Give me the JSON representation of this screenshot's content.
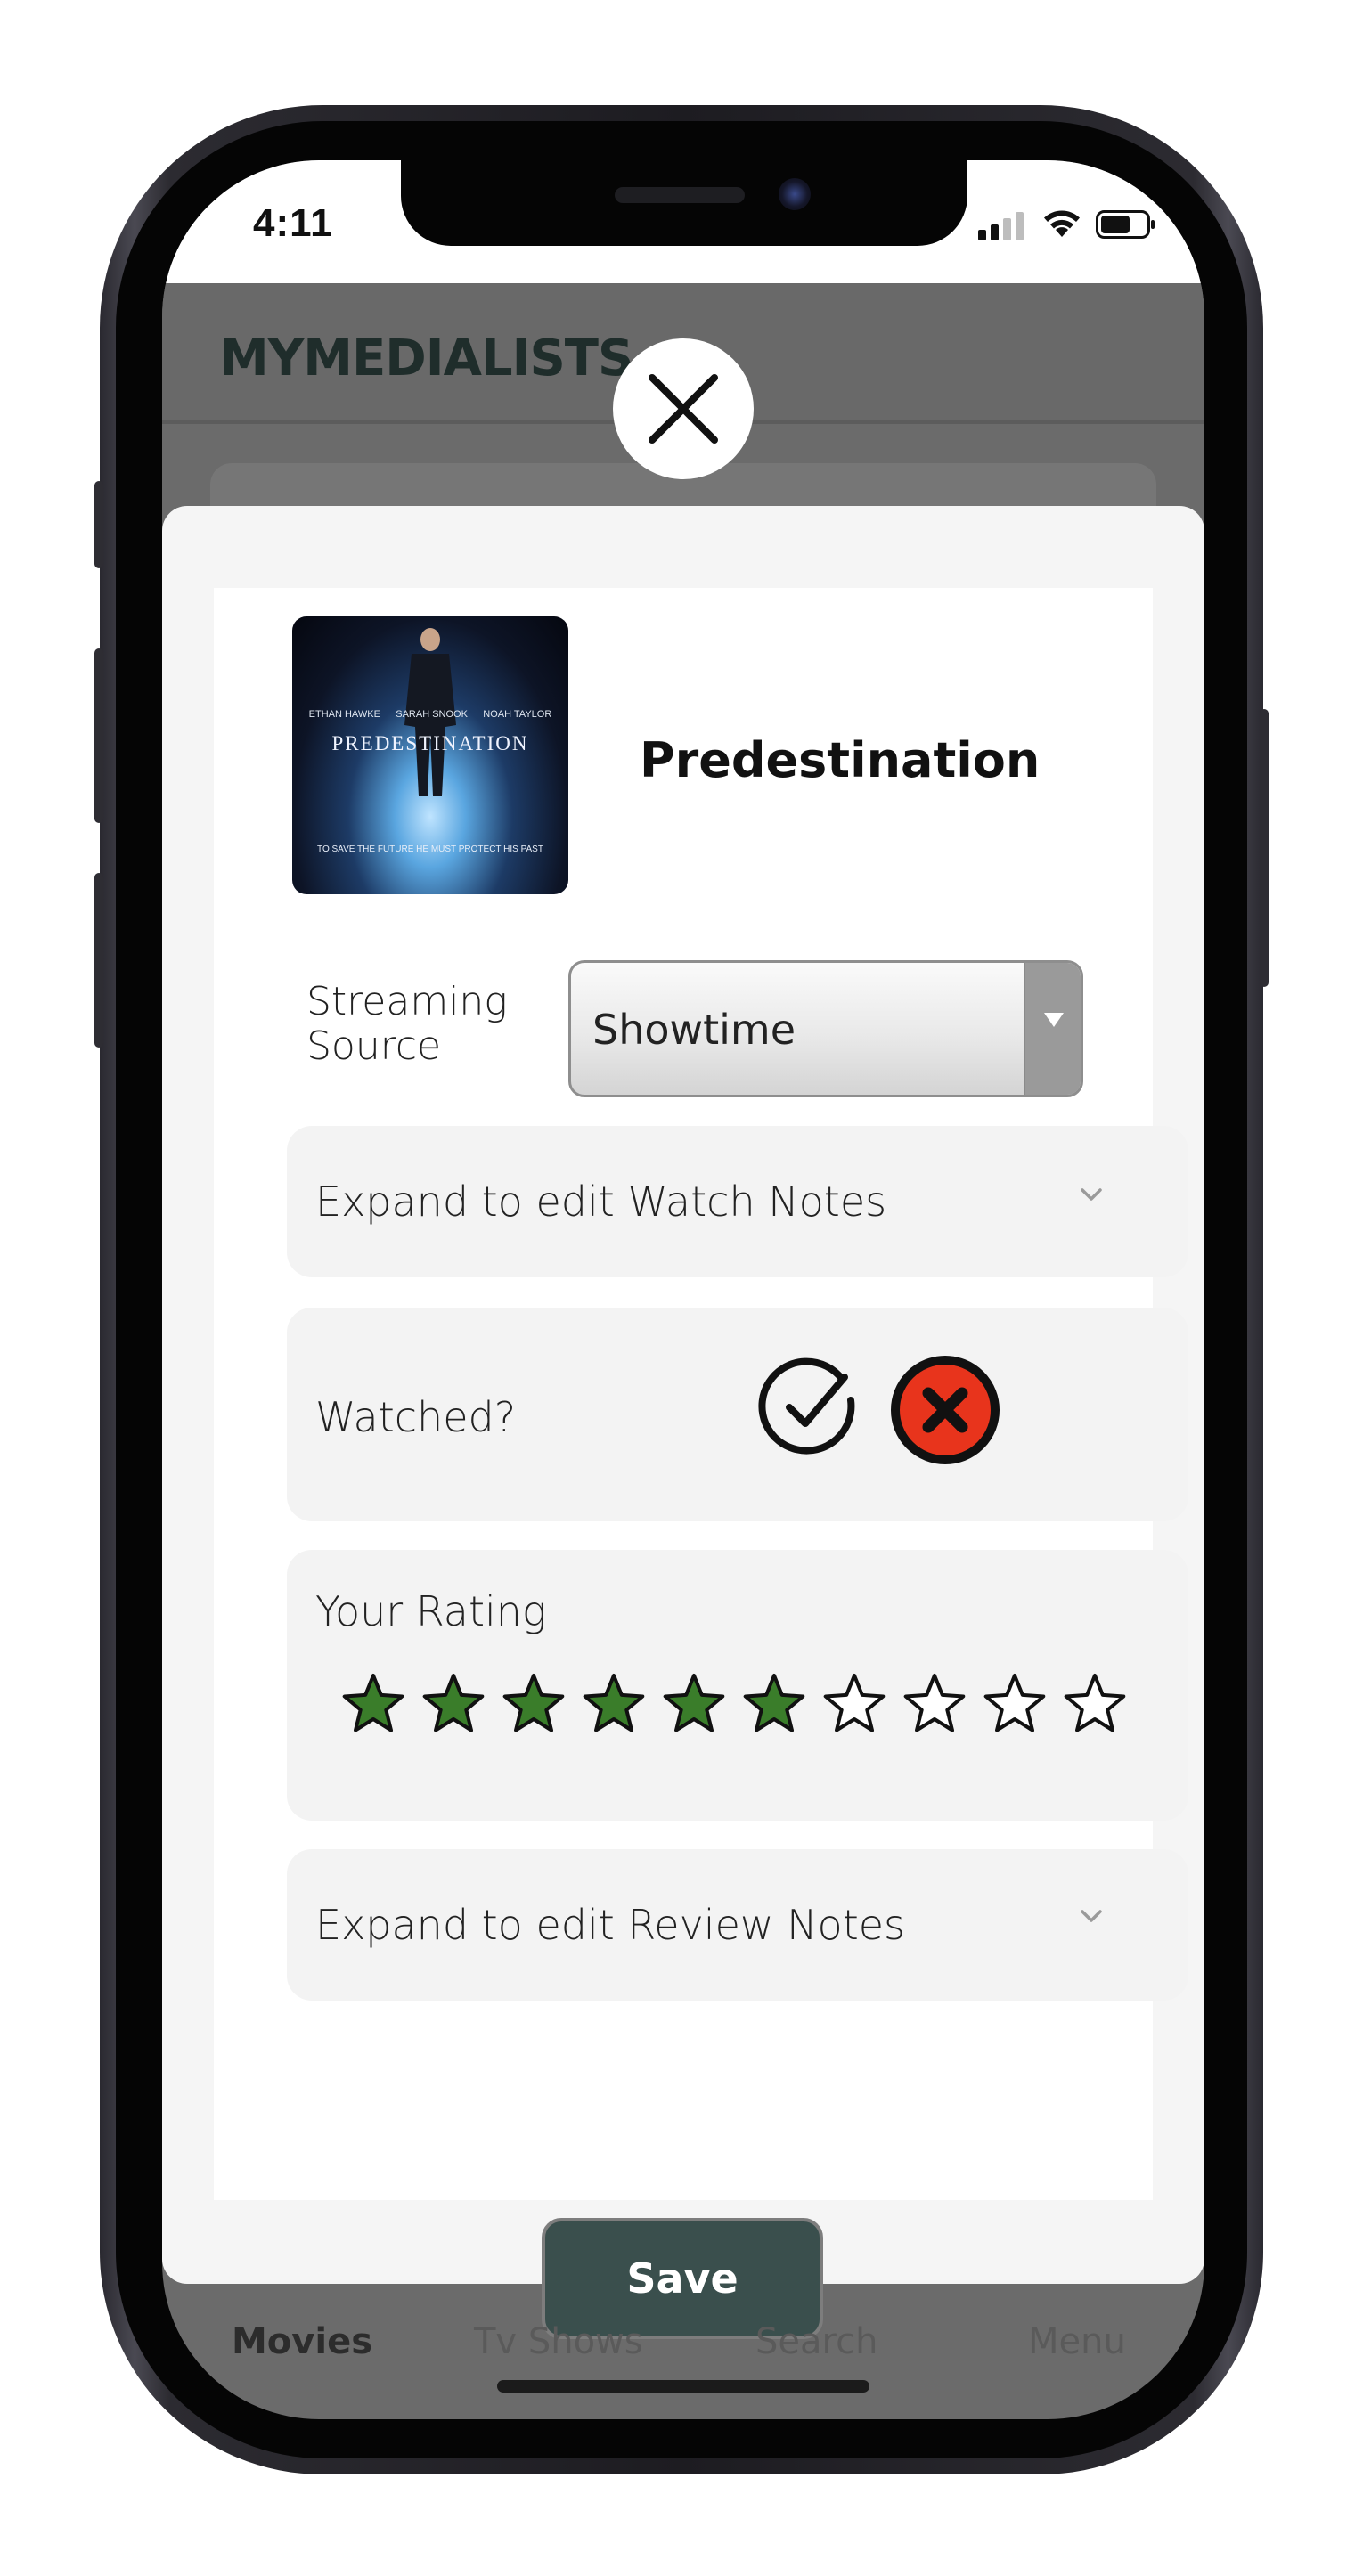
{
  "status_bar": {
    "time": "4:11"
  },
  "app": {
    "logo": "MYMEDIALISTS"
  },
  "modal": {
    "movie_title": "Predestination",
    "poster": {
      "title": "PREDESTINATION",
      "names": [
        "ETHAN HAWKE",
        "SARAH SNOOK",
        "NOAH TAYLOR"
      ],
      "tagline": "TO SAVE THE FUTURE HE MUST PROTECT HIS PAST"
    },
    "streaming_source": {
      "label": "Streaming Source",
      "selected": "Showtime"
    },
    "watch_notes": {
      "label": "Expand to edit Watch Notes"
    },
    "watched": {
      "label": "Watched?"
    },
    "rating": {
      "label": "Your Rating",
      "value": 6,
      "max": 10
    },
    "review_notes": {
      "label": "Expand to edit Review Notes"
    },
    "save_label": "Save"
  },
  "tabs": [
    {
      "label": "Movies",
      "active": true
    },
    {
      "label": "Tv Shows",
      "active": false
    },
    {
      "label": "Search",
      "active": false
    },
    {
      "label": "Menu",
      "active": false
    }
  ],
  "colors": {
    "star_filled": "#3a7d2a",
    "save_button": "#3a4f4d",
    "unwatched_red": "#e8341c",
    "logo": "#1f2d2b"
  }
}
